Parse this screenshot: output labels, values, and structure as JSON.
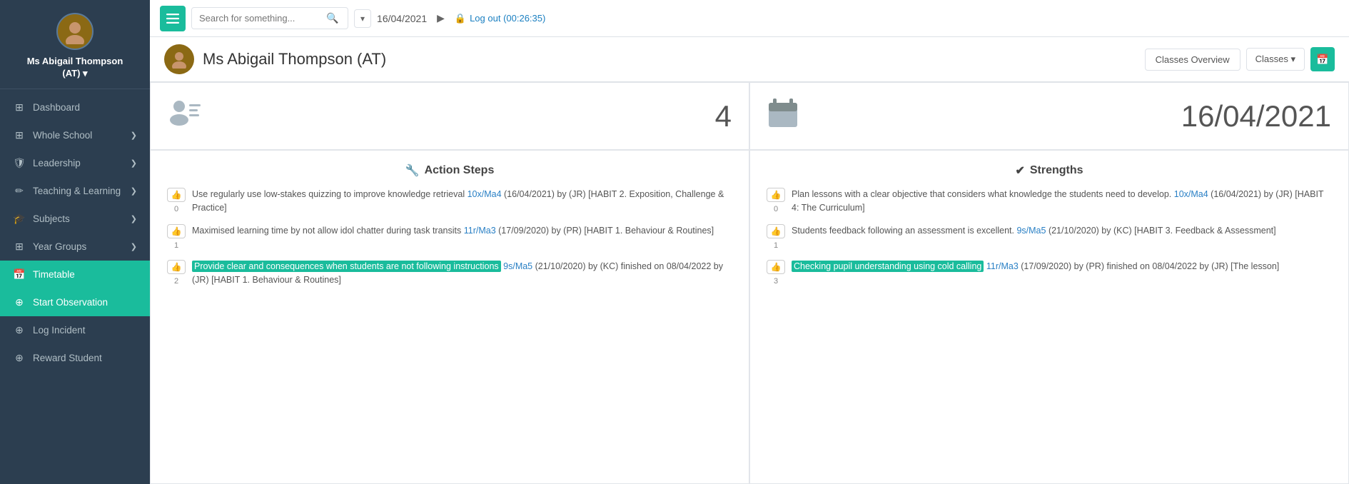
{
  "sidebar": {
    "profile_name": "Ms Abigail Thompson\n(AT) ▾",
    "items": [
      {
        "id": "dashboard",
        "label": "Dashboard",
        "icon": "⊞",
        "active": false,
        "has_chevron": false
      },
      {
        "id": "whole-school",
        "label": "Whole School",
        "icon": "⊞",
        "active": false,
        "has_chevron": true
      },
      {
        "id": "leadership",
        "label": "Leadership",
        "icon": "🛡",
        "active": false,
        "has_chevron": true
      },
      {
        "id": "teaching-learning",
        "label": "Teaching & Learning",
        "icon": "✏",
        "active": false,
        "has_chevron": true
      },
      {
        "id": "subjects",
        "label": "Subjects",
        "icon": "🎓",
        "active": false,
        "has_chevron": true
      },
      {
        "id": "year-groups",
        "label": "Year Groups",
        "icon": "⊞",
        "active": false,
        "has_chevron": true
      },
      {
        "id": "timetable",
        "label": "Timetable",
        "icon": "📅",
        "active": true,
        "has_chevron": false
      },
      {
        "id": "start-observation",
        "label": "Start Observation",
        "icon": "⊕",
        "active": false,
        "has_chevron": false
      },
      {
        "id": "log-incident",
        "label": "Log Incident",
        "icon": "⊕",
        "active": false,
        "has_chevron": false
      },
      {
        "id": "reward-student",
        "label": "Reward Student",
        "icon": "⊕",
        "active": false,
        "has_chevron": false
      }
    ]
  },
  "topbar": {
    "search_placeholder": "Search for something...",
    "date": "16/04/2021",
    "logout_label": "Log out (00:26:35)"
  },
  "header": {
    "title": "Ms Abigail Thompson (AT)",
    "classes_overview_label": "Classes Overview",
    "classes_label": "Classes ▾"
  },
  "stats": {
    "left_icon": "👥",
    "left_number": "4",
    "right_icon": "📅",
    "right_date": "16/04/2021"
  },
  "action_steps": {
    "title": "Action Steps",
    "title_icon": "🔧",
    "items": [
      {
        "like_count": "0",
        "text": "Use regularly use low-stakes quizzing to improve knowledge retrieval",
        "link1": "10x/Ma4",
        "date1": "(16/04/2021)",
        "by1": "by (JR)",
        "habit": "[HABIT 2. Exposition, Challenge & Practice]",
        "highlighted": false
      },
      {
        "like_count": "1",
        "text": "Maximised learning time by not allow idol chatter during task transits",
        "link1": "11r/Ma3",
        "date1": "(17/09/2020)",
        "by1": "by (PR)",
        "habit": "[HABIT 1. Behaviour & Routines]",
        "highlighted": false
      },
      {
        "like_count": "2",
        "text": "Provide clear and consequences when students are not following instructions",
        "link1": "9s/Ma5",
        "date1": "(21/10/2020)",
        "by1": "by (KC) finished on 08/04/2022 by (JR)",
        "habit": "[HABIT 1. Behaviour & Routines]",
        "highlighted": true
      }
    ]
  },
  "strengths": {
    "title": "Strengths",
    "title_icon": "✔",
    "items": [
      {
        "like_count": "0",
        "text": "Plan lessons with a clear objective that considers what knowledge the students need to develop.",
        "link1": "10x/Ma4",
        "date1": "(16/04/2021)",
        "by1": "by (JR)",
        "habit": "[HABIT 4: The Curriculum]",
        "highlighted": false
      },
      {
        "like_count": "1",
        "text": "Students feedback following an assessment is excellent.",
        "link1": "9s/Ma5",
        "date1": "(21/10/2020)",
        "by1": "by (KC)",
        "habit": "[HABIT 3. Feedback & Assessment]",
        "highlighted": false
      },
      {
        "like_count": "3",
        "text": "Checking pupil understanding using cold calling",
        "link1": "11r/Ma3",
        "date1": "(17/09/2020)",
        "by1": "by (PR) finished on 08/04/2022 by (JR)",
        "habit": "[The lesson]",
        "highlighted": true
      }
    ]
  }
}
